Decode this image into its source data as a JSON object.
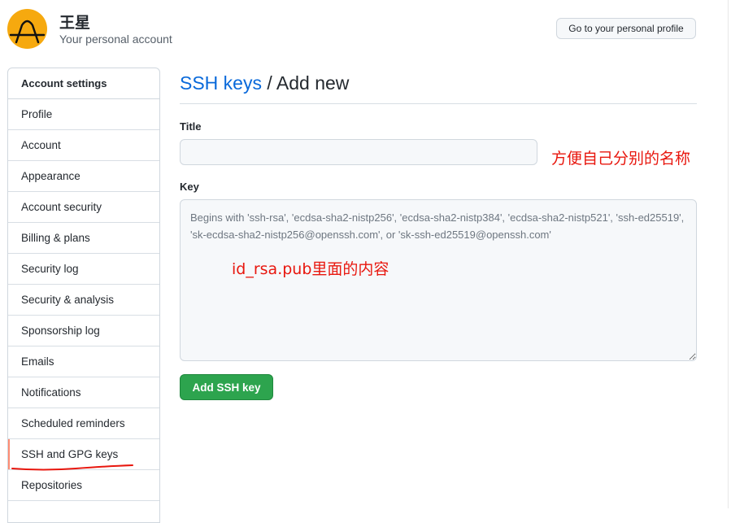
{
  "header": {
    "user_name": "王星",
    "subtitle": "Your personal account",
    "profile_button": "Go to your personal profile",
    "avatar_color": "#f6a90f"
  },
  "sidebar": {
    "heading": "Account settings",
    "items": [
      {
        "label": "Profile"
      },
      {
        "label": "Account"
      },
      {
        "label": "Appearance"
      },
      {
        "label": "Account security"
      },
      {
        "label": "Billing & plans"
      },
      {
        "label": "Security log"
      },
      {
        "label": "Security & analysis"
      },
      {
        "label": "Sponsorship log"
      },
      {
        "label": "Emails"
      },
      {
        "label": "Notifications"
      },
      {
        "label": "Scheduled reminders"
      },
      {
        "label": "SSH and GPG keys",
        "selected": true
      },
      {
        "label": "Repositories"
      }
    ]
  },
  "main": {
    "breadcrumb_link": "SSH keys",
    "separator": " / ",
    "page_title": "Add new",
    "title_label": "Title",
    "title_value": "",
    "key_label": "Key",
    "key_value": "",
    "key_placeholder": "Begins with 'ssh-rsa', 'ecdsa-sha2-nistp256', 'ecdsa-sha2-nistp384', 'ecdsa-sha2-nistp521', 'ssh-ed25519', 'sk-ecdsa-sha2-nistp256@openssh.com', or 'sk-ssh-ed25519@openssh.com'",
    "submit_button": "Add SSH key"
  },
  "annotations": {
    "title_note": "方便自己分别的名称",
    "key_note": "id_rsa.pub里面的内容",
    "color": "#e8170e"
  },
  "colors": {
    "link": "#0969da",
    "primary_button": "#2da44e",
    "selected_indicator": "#fd8c73"
  }
}
